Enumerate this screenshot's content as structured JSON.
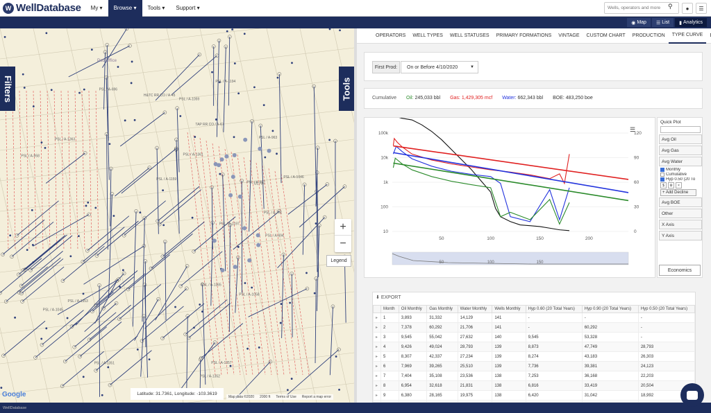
{
  "brand": {
    "name": "WellDatabase",
    "mark": "W"
  },
  "nav": {
    "menu": [
      {
        "label": "My ▾",
        "active": false
      },
      {
        "label": "Browse ▾",
        "active": true
      },
      {
        "label": "Tools ▾",
        "active": false
      },
      {
        "label": "Support ▾",
        "active": false
      }
    ],
    "search_placeholder": "Wells, operators and more",
    "search_icon": "search-icon",
    "user_icon": "user-icon",
    "menu_icon": "hamburger-icon"
  },
  "view_tabs": [
    {
      "label": "Map",
      "icon": "map-icon",
      "active": false
    },
    {
      "label": "List",
      "icon": "list-icon",
      "active": false
    },
    {
      "label": "Analytics",
      "icon": "analytics-icon",
      "active": true
    }
  ],
  "map": {
    "filters_label": "Filters",
    "tools_label": "Tools",
    "zoom_in": "+",
    "zoom_out": "−",
    "legend_label": "Legend",
    "coords": "Latitude: 31.7361, Longitude: -103.3619",
    "google": "Google",
    "footer": [
      "Map data ©2020",
      "2000 ft",
      "Terms of Use",
      "Report a map error"
    ],
    "parcel_labels": [
      "PSL / A-1351",
      "PSL / A-1352",
      "PSL / A-1357",
      "PSL / A-1353",
      "PSL / A-958",
      "PSL / A-1361",
      "PSL / A-694",
      "PSL / A-696",
      "PSL / A-1363",
      "PSL / A-1365",
      "PSL / A-1058",
      "PSL / A-1194",
      "PSL / A-771",
      "PSL / A-962",
      "PSL / A-1059",
      "PSL / A-963",
      "PSL / A-1197",
      "PSL / A-1045",
      "PSL / A-1046",
      "UL / A-",
      "TAP RR CO / A-67",
      "H&TC RR CO / A-45",
      "PSL / A-1159"
    ],
    "place_label": "Pad Office"
  },
  "analytics": {
    "tabs": [
      {
        "label": "OPERATORS",
        "active": false
      },
      {
        "label": "WELL TYPES",
        "active": false
      },
      {
        "label": "WELL STATUSES",
        "active": false
      },
      {
        "label": "PRIMARY FORMATIONS",
        "active": false
      },
      {
        "label": "VINTAGE",
        "active": false
      },
      {
        "label": "CUSTOM CHART",
        "active": false
      },
      {
        "label": "PRODUCTION",
        "active": false
      },
      {
        "label": "TYPE CURVE",
        "active": true
      },
      {
        "label": "ECONOMI",
        "active": false
      }
    ],
    "first_prod_label": "First Prod:",
    "first_prod_value": "On or Before 4/10/2020",
    "cumulative": {
      "label": "Cumulative",
      "oil_label": "Oil:",
      "oil": "245,033 bbl",
      "gas_label": "Gas:",
      "gas": "1,429,305 mcf",
      "water_label": "Water:",
      "water": "662,343 bbl",
      "boe_label": "BOE:",
      "boe": "483,250 boe"
    },
    "side": {
      "quick_plot": "Quick Plot",
      "buttons": [
        "Avg Oil",
        "Avg Gas",
        "Avg Water"
      ],
      "monthly": "Monthly",
      "monthly_checked": true,
      "cumulative": "Cumulative",
      "cumulative_checked": false,
      "hyp": "Hyp 0.50 (20 To",
      "hyp_checked": true,
      "add_decline": "+ Add Decline",
      "buttons2": [
        "Avg BOE",
        "Other",
        "X Axis",
        "Y Axis"
      ],
      "economics": "Economics"
    },
    "table": {
      "export_label": "EXPORT",
      "columns": [
        "",
        "Month",
        "Oil Monthly",
        "Gas Monthly",
        "Water Monthly",
        "Wells Monthly",
        "Hyp 0.60 (20 Total Years)",
        "Hyp 0.90 (20 Total Years)",
        "Hyp 0.50 (20 Total Years)"
      ],
      "rows": [
        [
          "▸",
          "1",
          "3,893",
          "31,332",
          "14,129",
          "141",
          "-",
          "-",
          "-"
        ],
        [
          "▸",
          "2",
          "7,378",
          "60,292",
          "21,706",
          "141",
          "-",
          "60,292",
          "-"
        ],
        [
          "▸",
          "3",
          "9,545",
          "55,042",
          "27,632",
          "140",
          "9,545",
          "53,328",
          "-"
        ],
        [
          "▸",
          "4",
          "9,426",
          "49,024",
          "28,793",
          "139",
          "8,873",
          "47,749",
          "28,793"
        ],
        [
          "▸",
          "5",
          "8,307",
          "42,337",
          "27,234",
          "139",
          "8,274",
          "43,183",
          "26,303"
        ],
        [
          "▸",
          "6",
          "7,969",
          "39,265",
          "25,510",
          "139",
          "7,736",
          "39,381",
          "24,123"
        ],
        [
          "▸",
          "7",
          "7,404",
          "35,108",
          "23,536",
          "138",
          "7,253",
          "36,168",
          "22,203"
        ],
        [
          "▸",
          "8",
          "6,954",
          "32,618",
          "21,831",
          "138",
          "6,816",
          "33,419",
          "20,504"
        ],
        [
          "▸",
          "9",
          "6,380",
          "28,165",
          "19,975",
          "138",
          "6,420",
          "31,042",
          "18,992"
        ],
        [
          "▸",
          "10",
          "5,554",
          "27,376",
          "17,719",
          "138",
          "6,059",
          "28,967",
          "17,641"
        ]
      ]
    }
  },
  "chart_data": {
    "type": "line",
    "title": "",
    "xlabel": "",
    "ylabel": "",
    "y_scale": "log",
    "ylim": [
      10,
      100000
    ],
    "y_ticks": [
      "100k",
      "10k",
      "1k",
      "100",
      "10"
    ],
    "y2lim": [
      0,
      120
    ],
    "y2_ticks": [
      "120",
      "90",
      "60",
      "30",
      "0"
    ],
    "xlim": [
      0,
      240
    ],
    "x_ticks": [
      "50",
      "100",
      "150",
      "200"
    ],
    "navigator_ticks": [
      "50",
      "100",
      "150"
    ],
    "colors": {
      "oil": "#2a8a2a",
      "gas": "#e02020",
      "water": "#2233dd",
      "wells": "#111111"
    },
    "series": [
      {
        "key": "wells",
        "axis": "y2",
        "x": [
          1,
          10,
          20,
          30,
          40,
          50,
          60,
          70,
          80,
          90,
          100,
          105,
          110,
          120,
          130,
          140,
          150,
          160,
          170,
          180
        ],
        "y": [
          141,
          138,
          136,
          130,
          122,
          112,
          100,
          88,
          76,
          62,
          48,
          28,
          18,
          12,
          8,
          7,
          6,
          4,
          2,
          1
        ]
      },
      {
        "key": "gas",
        "x": [
          1,
          2,
          5,
          10,
          20,
          40,
          60,
          80,
          100,
          120,
          140,
          160,
          170,
          175,
          180
        ],
        "y": [
          31332,
          60292,
          42337,
          27376,
          14000,
          8000,
          5600,
          4200,
          3200,
          2600,
          2000,
          1400,
          2200,
          900,
          14000
        ]
      },
      {
        "key": "water",
        "x": [
          1,
          4,
          10,
          20,
          40,
          60,
          80,
          100,
          110,
          120,
          140,
          160,
          170,
          180
        ],
        "y": [
          14129,
          28793,
          17719,
          9000,
          4500,
          2800,
          2100,
          1700,
          900,
          40,
          25,
          500,
          30,
          600
        ]
      },
      {
        "key": "oil",
        "x": [
          1,
          3,
          10,
          20,
          40,
          60,
          80,
          100,
          110,
          120,
          140,
          160,
          170,
          180
        ],
        "y": [
          3893,
          9545,
          5554,
          3200,
          1700,
          1100,
          800,
          600,
          40,
          60,
          30,
          200,
          20,
          150
        ]
      },
      {
        "key": "gas_fit",
        "x": [
          1,
          240
        ],
        "y": [
          30000,
          1300
        ]
      },
      {
        "key": "water_fit",
        "x": [
          1,
          240
        ],
        "y": [
          16000,
          380
        ]
      },
      {
        "key": "oil_fit",
        "x": [
          1,
          240
        ],
        "y": [
          6000,
          180
        ]
      }
    ]
  }
}
